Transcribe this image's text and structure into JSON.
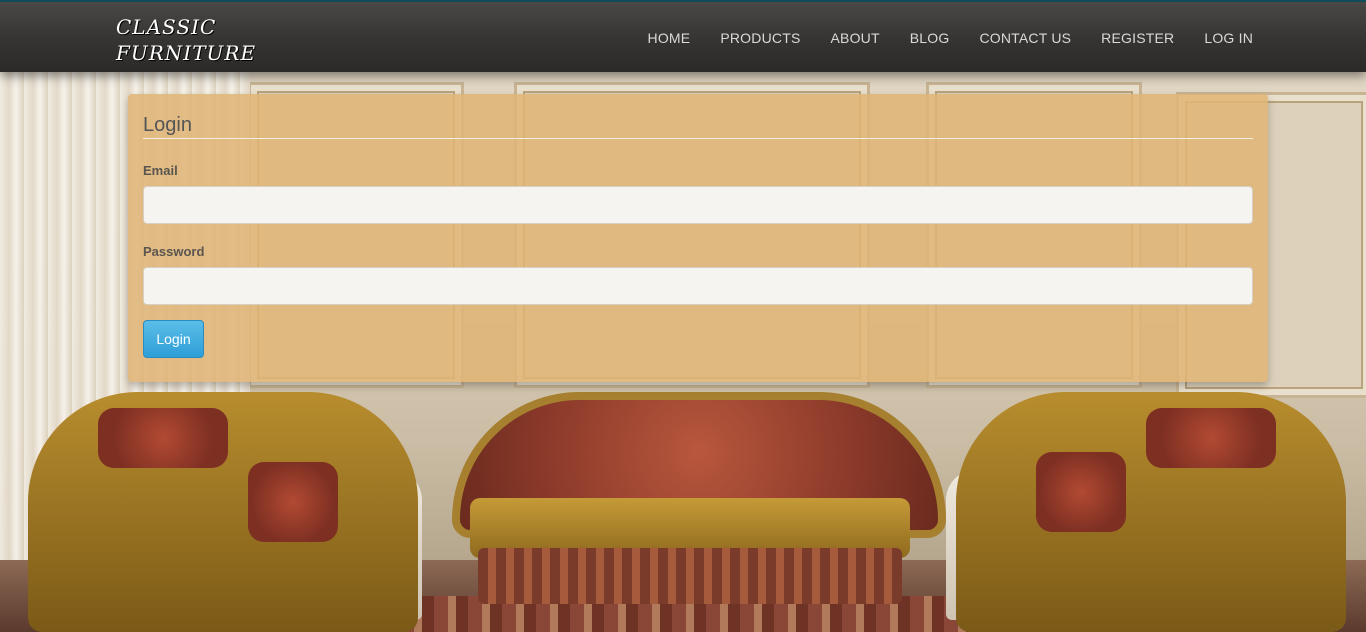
{
  "brand": {
    "line1": "CLASSIC",
    "line2": "FURNITURE"
  },
  "nav": {
    "items": [
      {
        "label": "HOME"
      },
      {
        "label": "PRODUCTS"
      },
      {
        "label": "ABOUT"
      },
      {
        "label": "BLOG"
      },
      {
        "label": "CONTACT US"
      },
      {
        "label": "REGISTER"
      },
      {
        "label": "LOG IN"
      }
    ]
  },
  "login": {
    "title": "Login",
    "email_label": "Email",
    "email_value": "",
    "password_label": "Password",
    "password_value": "",
    "submit_label": "Login"
  },
  "colors": {
    "navbar": "#363432",
    "panel": "#e0b476",
    "button": "#3aa8dd"
  }
}
